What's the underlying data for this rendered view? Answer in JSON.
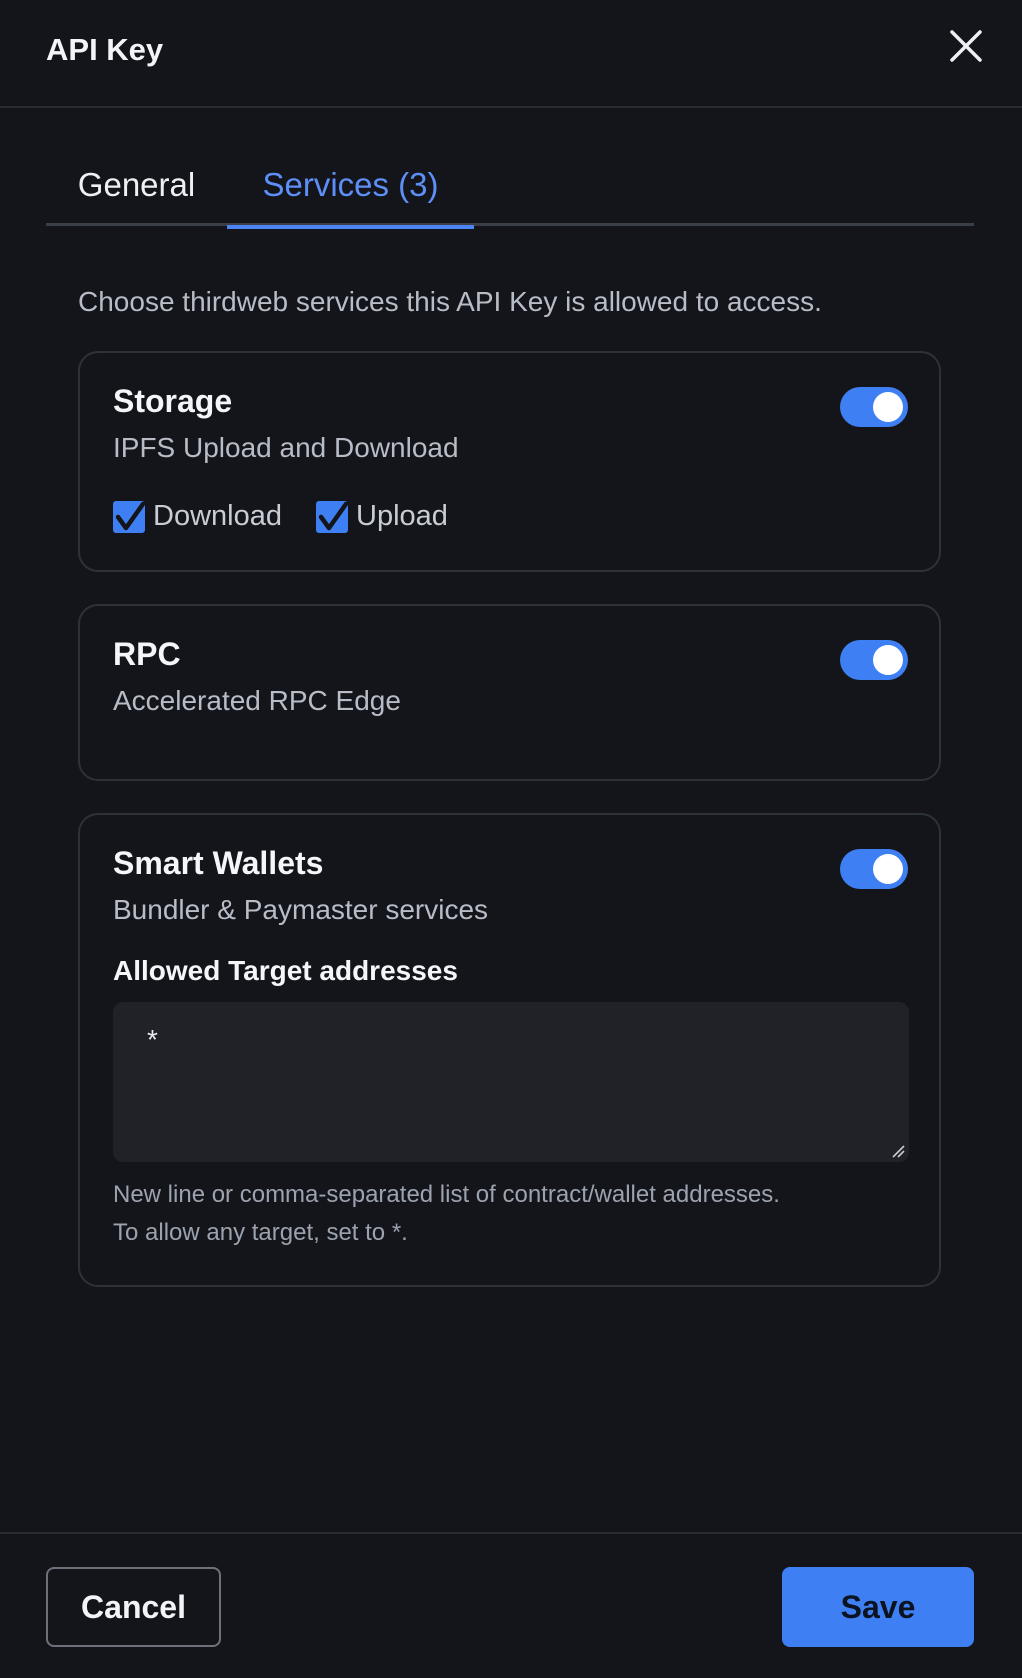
{
  "dialog": {
    "title": "API Key"
  },
  "tabs": [
    {
      "label": "General",
      "active": false
    },
    {
      "label": "Services (3)",
      "active": true
    }
  ],
  "description": "Choose thirdweb services this API Key is allowed to access.",
  "services": {
    "storage": {
      "title": "Storage",
      "subtitle": "IPFS Upload and Download",
      "enabled": true,
      "actions": [
        {
          "label": "Download",
          "checked": true
        },
        {
          "label": "Upload",
          "checked": true
        }
      ]
    },
    "rpc": {
      "title": "RPC",
      "subtitle": "Accelerated RPC Edge",
      "enabled": true
    },
    "smart_wallets": {
      "title": "Smart Wallets",
      "subtitle": "Bundler & Paymaster services",
      "enabled": true,
      "field_label": "Allowed Target addresses",
      "field_value": "*",
      "helper_line_1": "New line or comma-separated list of contract/wallet addresses.",
      "helper_line_2": "To allow any target, set to *."
    }
  },
  "footer": {
    "cancel_label": "Cancel",
    "save_label": "Save"
  },
  "colors": {
    "background": "#13151b",
    "accent": "#3e80f4",
    "active_tab_text": "#5d8ff7",
    "card_border": "#2d3139",
    "muted_text": "#b7bcc6"
  },
  "icons": {
    "close": "close-icon",
    "checkbox": "checkmark-icon",
    "resize": "resize-grip-icon"
  }
}
